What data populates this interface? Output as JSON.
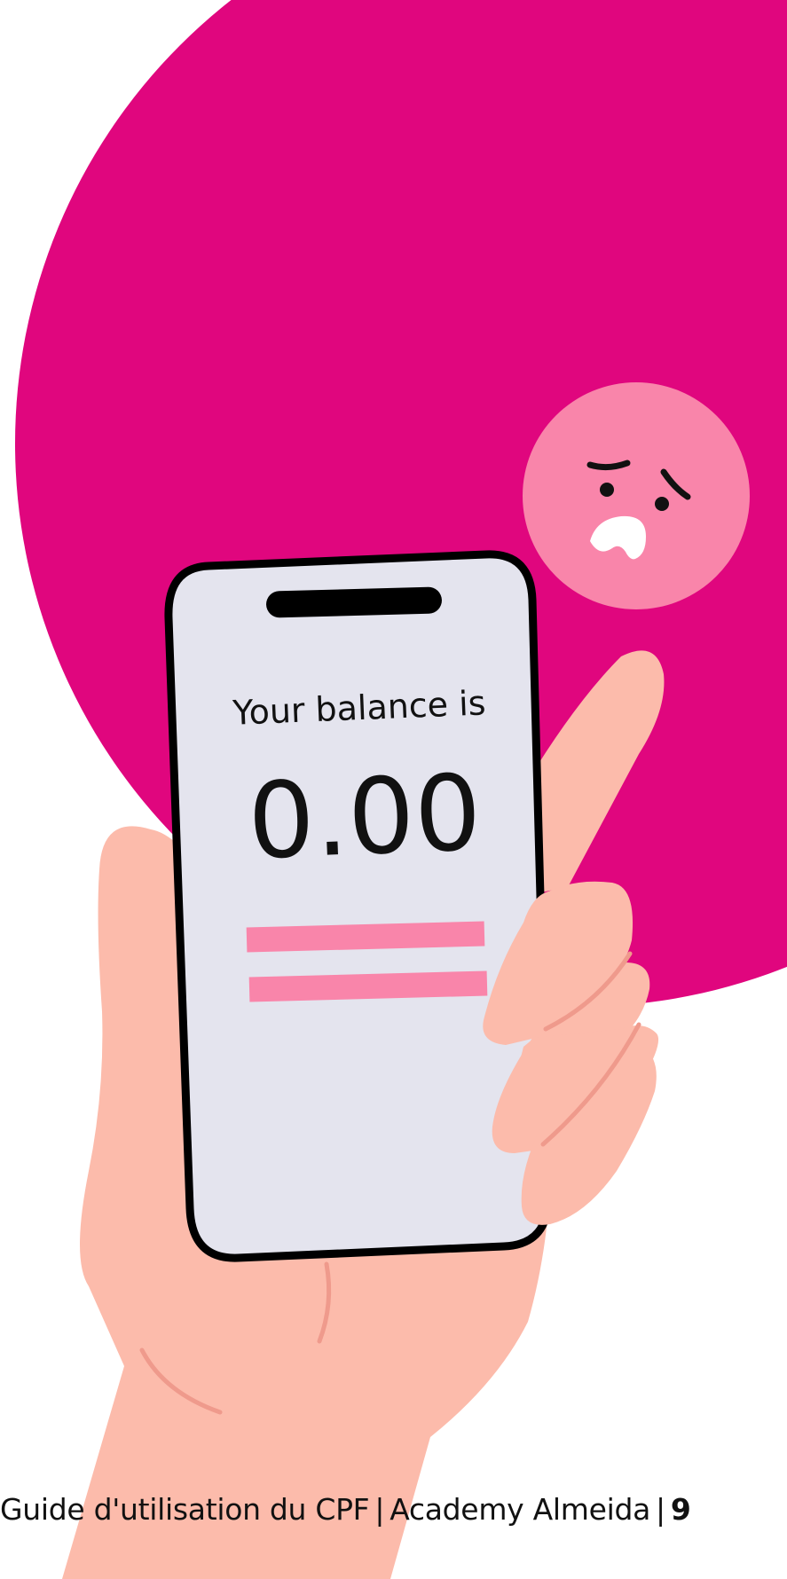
{
  "phone": {
    "balance_label": "Your balance is",
    "balance_value": "0.00"
  },
  "footer": {
    "guide_title": "Guide d'utilisation du CPF",
    "separator": "|",
    "academy_name": "Academy Almeida",
    "page_number": "9"
  },
  "colors": {
    "magenta_circle": "#E0067E",
    "emoji_pink": "#F985AA",
    "skin": "#FCBBAB",
    "skin_line": "#EF9A8C",
    "screen": "#E4E4EE",
    "bar_pink": "#F985AA"
  },
  "icons": {
    "emoji": "worried-face-icon"
  }
}
